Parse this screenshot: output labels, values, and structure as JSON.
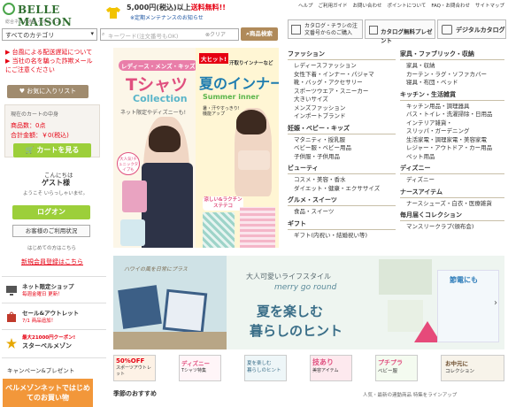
{
  "header": {
    "logo_text": "BELLE MAISON",
    "logo_tagline": "総合ネット通販 ベルメゾン",
    "promo_amount": "5,000円(税込)以上",
    "promo_free": "送料無料!!",
    "maintenance": "※定期メンテナンスのお知らせ",
    "top_links": [
      "ヘルプ",
      "ご利用ガイド",
      "お問い合わせ",
      "ポイントについて",
      "FAQ・お問合わせ",
      "サイトマップ"
    ],
    "brand_color": "#4aa54a"
  },
  "search": {
    "category_value": "すべてのカテゴリ",
    "placeholder": "キーワード(注文番号もOK)",
    "clear_label": "クリア",
    "button_label": "商品検索"
  },
  "catalog": {
    "order_label": "カタログ・チラシの注文番号からのご購入",
    "free_label": "カタログ無料プレゼント",
    "digital_label": "デジタルカタログ"
  },
  "notices": [
    "台風による配送遅延について",
    "当社の名を騙った詐欺メールにご注意ください"
  ],
  "sidebar": {
    "favorites_label": "お気に入りリスト",
    "cart_heading": "現在のカートの中身",
    "cart_qty": "商品数：0点",
    "cart_amount": "合計金額：￥0(税込)",
    "cart_button": "カートを見る",
    "greeting": "こんにちは",
    "guest_name": "ゲスト様",
    "welcome": "ようこそ いらっしゃいませ。",
    "login_button": "ログオン",
    "help_button": "お客様のご利用状況",
    "first_time": "はじめての方はこちら",
    "register_link": "新規会員登録はこちら",
    "items": [
      {
        "title": "ネット限定ショップ",
        "sub": "毎週金曜日 更新！"
      },
      {
        "title": "セール&アウトレット",
        "sub": "7/1 商品追加！"
      },
      {
        "title": "最大21000円クーポン!",
        "sub": "スターベルメゾン"
      }
    ],
    "campaign_heading": "キャンペーン&プレゼント",
    "first_banner": "ベルメゾンネットではじめてのお買い物"
  },
  "main_banner": {
    "left_tag": "レディース・メンズ・キッズ",
    "left_title": "Tシャツ",
    "left_sub": "Collection",
    "left_note": "ネット限定やディズニーも!",
    "left_bubble": "大人気!チュニックタイプも",
    "right_tag": "大ヒット!",
    "right_tag2": "汗取りインナーなど",
    "right_title": "夏のインナー",
    "right_sub": "Summer inner",
    "right_note": "暑・汗やすっきり!機能アップ",
    "right_bubble": "涼しい&ラクチンステテコ"
  },
  "categories": {
    "col1": [
      {
        "heading": "ファッション",
        "items": [
          "レディースファッション",
          "女性下着・インナー・パジャマ",
          "靴・バッグ・アクセサリー",
          "スポーツウエア・スニーカー",
          "大きいサイズ",
          "メンズファッション",
          "インポートブランド"
        ]
      },
      {
        "heading": "妊娠・ベビー・キッズ",
        "items": [
          "マタニティ・授乳服",
          "ベビー服・ベビー用品",
          "子供服・子供用品"
        ]
      },
      {
        "heading": "ビューティ",
        "items": [
          "コスメ・美容・香水",
          "ダイエット・健康・エクササイズ"
        ]
      },
      {
        "heading": "グルメ・スイーツ",
        "items": [
          "食品・スイーツ"
        ]
      },
      {
        "heading": "ギフト",
        "items": [
          "ギフト(内祝い・結婚祝い等)"
        ]
      }
    ],
    "col2": [
      {
        "heading": "家具・ファブリック・収納",
        "items": [
          "家具・収納",
          "カーテン・ラグ・ソファカバー",
          "寝具・布団・ベッド"
        ]
      },
      {
        "heading": "キッチン・生活雑貨",
        "items": [
          "キッチン用品・調理器具",
          "バス・トイレ・洗濯掃除・日用品",
          "インテリア雑貨・",
          "スリッパ・ガーデニング",
          "生活家電・調理家電・美容家電",
          "レジャー・アウトドア・カー用品",
          "ペット用品"
        ]
      },
      {
        "heading": "ディズニー",
        "items": [
          "ディズニー"
        ]
      },
      {
        "heading": "ナースアイテム",
        "items": [
          "ナースシューズ・白衣・医療雑貨"
        ]
      },
      {
        "heading": "毎月届くコレクション",
        "items": [
          "マンスリークラブ(頒布会)"
        ]
      }
    ]
  },
  "summer_banner": {
    "corner": "ハワイの風を日常にプラス",
    "headline": "大人可愛いライフスタイル",
    "brand": "merry go round",
    "title1": "夏を楽しむ",
    "title2": "暮らしのヒント",
    "eco": "節電にも"
  },
  "tiles": [
    {
      "line1": "50%OFF",
      "line2": "スポーツアウトレット"
    },
    {
      "line1": "ディズニー",
      "line2": "Tシャツ特集"
    },
    {
      "line1": "夏を楽しむ",
      "line2": "暮らしのヒント"
    },
    {
      "line1": "技あり",
      "line2": "美容アイテム"
    },
    {
      "line1": "プチプラ",
      "line2": "ベビー服"
    },
    {
      "line1": "お中元に",
      "line2": "コレクション"
    }
  ],
  "bottom": {
    "season_heading": "季節のおすすめ",
    "note": "人気・最新の連動商品 特集をラインアップ"
  }
}
